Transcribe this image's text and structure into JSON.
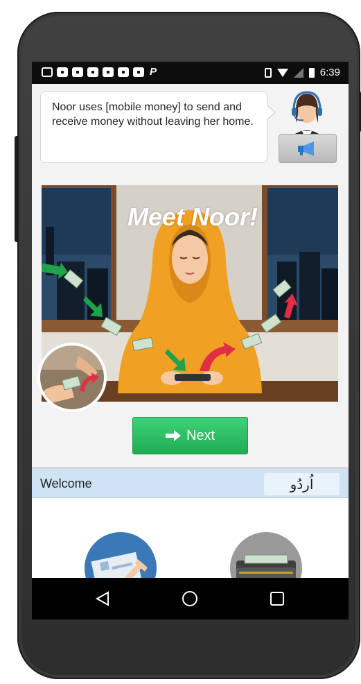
{
  "status_bar": {
    "time": "6:39",
    "notification_icons": [
      "notification-icon",
      "notification-icon",
      "notification-icon",
      "notification-icon",
      "notification-icon",
      "notification-icon",
      "notification-icon",
      "paypal-icon"
    ],
    "right_icons": [
      "vibrate-icon",
      "wifi-icon",
      "no-signal-icon",
      "battery-icon"
    ]
  },
  "guide": {
    "message": "Noor uses [mobile money] to send and receive money without leaving her home.",
    "agent_icon": "customer-service-agent-icon",
    "speaker_icon": "megaphone-icon"
  },
  "illustration": {
    "title": "Meet Noor!"
  },
  "next_button": {
    "icon": "arrow-right-icon",
    "label": "Next"
  },
  "tabs": {
    "welcome": "Welcome",
    "language": "اُردُو"
  },
  "cards": {
    "icons": [
      "form-signing-icon",
      "wallet-icon"
    ]
  },
  "nav_bar": {
    "icons": [
      "back-triangle-icon",
      "home-circle-icon",
      "recents-square-icon"
    ]
  },
  "colors": {
    "accent_green": "#2bbd63",
    "tab_bar_blue": "#cfe3f4",
    "scarf_orange": "#f0a022"
  }
}
